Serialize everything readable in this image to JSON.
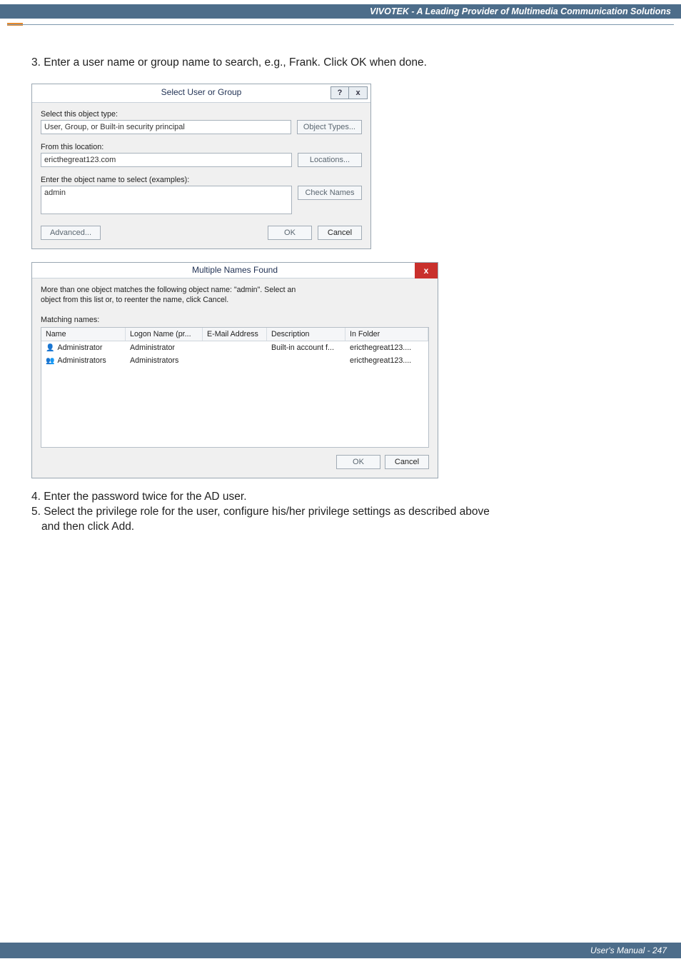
{
  "header": {
    "brand_text": "VIVOTEK - A Leading Provider of Multimedia Communication Solutions"
  },
  "doc": {
    "step3": "3. Enter a user name or group name to search, e.g., Frank. Click OK when done.",
    "step4": "4. Enter the password twice for the AD user.",
    "step5a": "5. Select the privilege role for the user, configure his/her privilege settings as described above",
    "step5b": "and then click Add."
  },
  "dlg_select": {
    "title": "Select User or Group",
    "help_symbol": "?",
    "close_symbol": "x",
    "lbl_object_type": "Select this object type:",
    "val_object_type": "User, Group, or Built-in security principal",
    "btn_object_types": "Object Types...",
    "lbl_from_location": "From this location:",
    "val_from_location": "ericthegreat123.com",
    "btn_locations": "Locations...",
    "lbl_enter_name_pre": "Enter the object name to select (",
    "lbl_enter_name_link": "examples",
    "lbl_enter_name_post": "):",
    "val_enter_name": "admin",
    "btn_check_names": "Check Names",
    "btn_advanced": "Advanced...",
    "btn_ok": "OK",
    "btn_cancel": "Cancel"
  },
  "dlg_multi": {
    "title": "Multiple Names Found",
    "close_symbol": "x",
    "msg_l1": "More than one object matches the following object name: \"admin\". Select an",
    "msg_l2": "object from this list or, to reenter the name, click Cancel.",
    "lbl_matching": "Matching names:",
    "cols": {
      "name": "Name",
      "logon": "Logon Name (pr...",
      "email": "E-Mail Address",
      "desc": "Description",
      "folder": "In Folder"
    },
    "rows": [
      {
        "name": "Administrator",
        "icon": "user",
        "logon": "Administrator",
        "email": "",
        "desc": "Built-in account f...",
        "folder": "ericthegreat123...."
      },
      {
        "name": "Administrators",
        "icon": "group",
        "logon": "Administrators",
        "email": "",
        "desc": "",
        "folder": "ericthegreat123...."
      }
    ],
    "btn_ok": "OK",
    "btn_cancel": "Cancel"
  },
  "footer": {
    "text": "User's Manual - 247"
  }
}
